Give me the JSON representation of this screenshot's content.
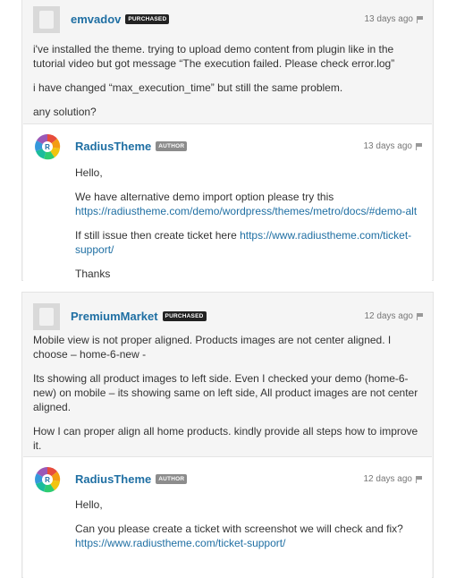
{
  "threads": [
    {
      "comment": {
        "username": "emvadov",
        "badge": "PURCHASED",
        "time": "13 days ago",
        "paragraphs": [
          "i've installed the theme. trying to upload demo content from plugin like in the tutorial video but got message “The execution failed. Please check error.log”",
          "i have changed “max_execution_time” but still the same problem.",
          "any solution?"
        ]
      },
      "reply": {
        "username": "RadiusTheme",
        "badge": "AUTHOR",
        "time": "13 days ago",
        "greeting": "Hello,",
        "p1_text": "We have alternative demo import option please try this",
        "p1_link": "https://radiustheme.com/demo/wordpress/themes/metro/docs/#demo-alt",
        "p2_text": "If still issue then create ticket here",
        "p2_link": "https://www.radiustheme.com/ticket-support/",
        "closing": "Thanks"
      }
    },
    {
      "comment": {
        "username": "PremiumMarket",
        "badge": "PURCHASED",
        "time": "12 days ago",
        "paragraphs": [
          "Mobile view is not proper aligned. Products images are not center aligned. I choose – home-6-new -",
          "Its showing all product images to left side. Even I checked your demo (home-6-new) on mobile – its showing same on left side, All product images are not center aligned.",
          "How I can proper align all home products. kindly provide all steps how to improve it."
        ]
      },
      "reply": {
        "username": "RadiusTheme",
        "badge": "AUTHOR",
        "time": "12 days ago",
        "greeting": "Hello,",
        "p1_text": "Can you please create a ticket with screenshot we will check and fix?",
        "p1_link": "https://www.radiustheme.com/ticket-support/"
      }
    }
  ],
  "colors": {
    "link": "#1f6fa3",
    "background": "#f5f5f5",
    "badge_purchased": "#222222",
    "badge_author": "#8c8c8c"
  }
}
